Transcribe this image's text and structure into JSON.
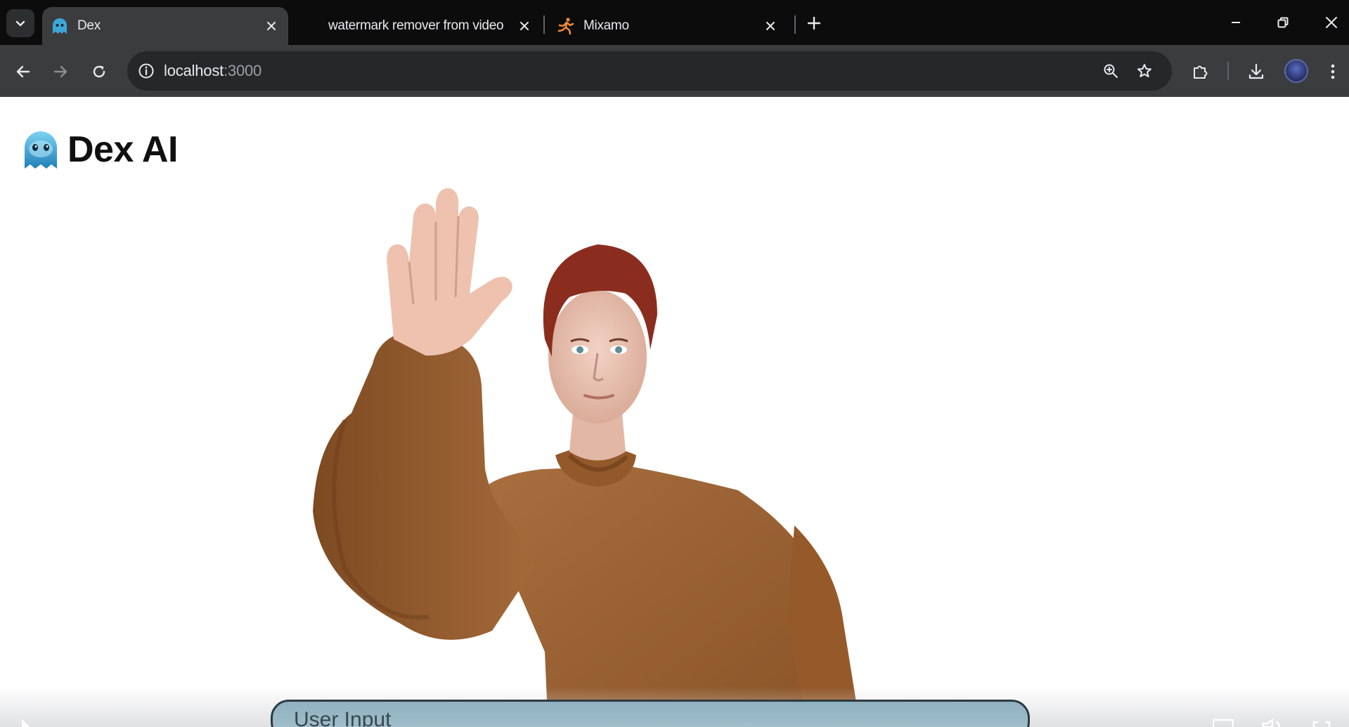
{
  "browser": {
    "tabs": [
      {
        "title": "Dex",
        "active": true,
        "favicon": "dex-ghost-icon"
      },
      {
        "title": "watermark remover from video",
        "active": false,
        "favicon": ""
      },
      {
        "title": "Mixamo",
        "active": false,
        "favicon": "mixamo-runner-icon"
      }
    ],
    "address": {
      "host": "localhost",
      "port": ":3000"
    },
    "colors": {
      "tabstrip": "#0c0c0d",
      "toolbar": "#3b3c3e",
      "omnibox": "#262729"
    }
  },
  "app": {
    "name": "Dex AI",
    "logo_icon": "dex-ghost-icon",
    "input_placeholder": "User Input",
    "accent": "#8fb1c0"
  }
}
